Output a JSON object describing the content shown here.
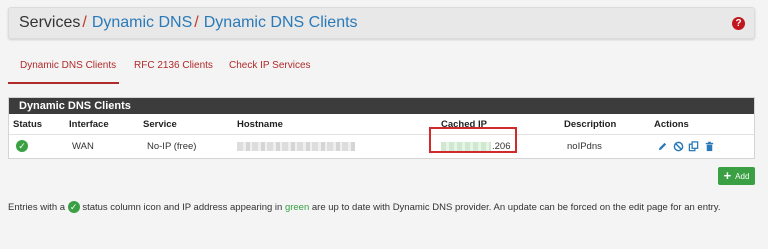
{
  "breadcrumb": {
    "root": "Services",
    "sep1": "/",
    "level1": "Dynamic DNS",
    "sep2": "/",
    "level2": "Dynamic DNS Clients"
  },
  "help_icon_text": "?",
  "tabs": [
    {
      "label": "Dynamic DNS Clients",
      "active": true
    },
    {
      "label": "RFC 2136 Clients",
      "active": false
    },
    {
      "label": "Check IP Services",
      "active": false
    }
  ],
  "panel": {
    "title": "Dynamic DNS Clients",
    "columns": [
      "Status",
      "Interface",
      "Service",
      "Hostname",
      "Cached IP",
      "Description",
      "Actions"
    ],
    "rows": [
      {
        "status_icon": "check-circle-icon",
        "interface": "WAN",
        "service": "No-IP (free)",
        "cached_ip_suffix": ".206",
        "description": "noIPdns",
        "actions": [
          "edit-icon",
          "disable-icon",
          "copy-icon",
          "delete-icon"
        ]
      }
    ]
  },
  "add_button": {
    "icon": "+",
    "label": "Add"
  },
  "note": {
    "part1": "Entries with a",
    "part2": "status column icon and IP address appearing in",
    "green_word": "green",
    "part3": "are up to date with Dynamic DNS provider. An update can be forced on the edit page for an entry."
  },
  "colors": {
    "accent_red": "#b02a2a",
    "link_blue": "#2a7ab8",
    "ok_green": "#3aa043",
    "panel_header": "#3c3c3c",
    "highlight_box": "#d22a2a"
  }
}
